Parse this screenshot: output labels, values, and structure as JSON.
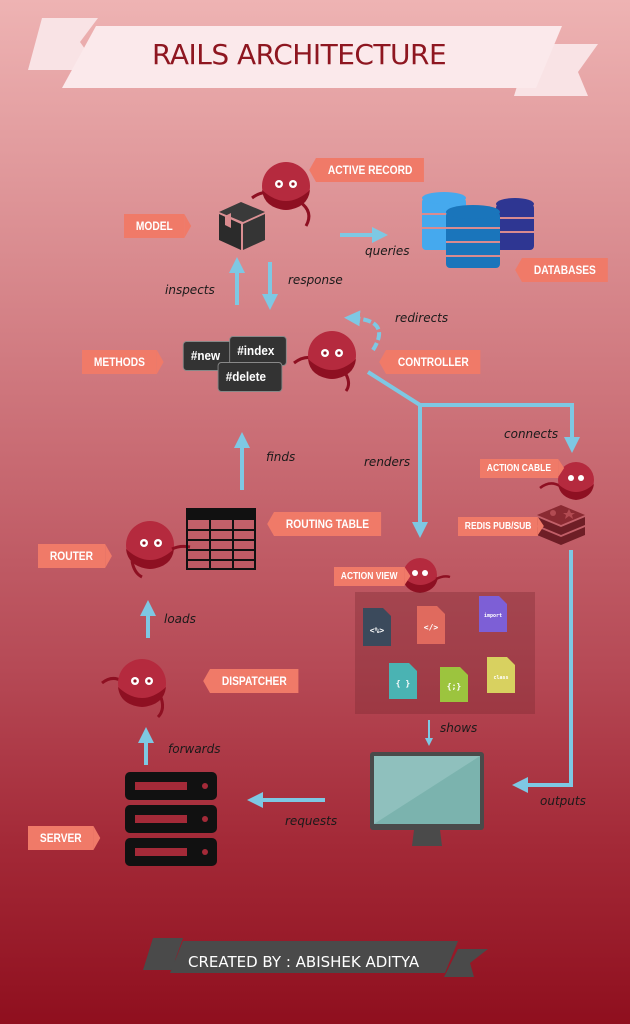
{
  "title": "RAILS ARCHITECTURE",
  "credit": "CREATED BY : ABISHEK ADITYA",
  "colors": {
    "tag": "#f07a68",
    "arrow": "#7ec8e3",
    "title_text": "#8e1620",
    "creature": "#b52a3e",
    "icon_dark": "#2b2b2b"
  },
  "labels": {
    "active_record": "ACTIVE RECORD",
    "model": "MODEL",
    "databases": "DATABASES",
    "methods": "METHODS",
    "controller": "CONTROLLER",
    "action_cable": "ACTION CABLE",
    "redis": "REDIS PUB/SUB",
    "routing_table": "ROUTING TABLE",
    "router": "ROUTER",
    "action_view": "ACTION VIEW",
    "dispatcher": "DISPATCHER",
    "server": "SERVER"
  },
  "notes": {
    "queries": "queries",
    "inspects": "inspects",
    "response": "response",
    "redirects": "redirects",
    "connects": "connects",
    "renders": "renders",
    "finds": "finds",
    "loads": "loads",
    "shows": "shows",
    "forwards": "forwards",
    "requests": "requests",
    "outputs": "outputs"
  },
  "methods": [
    "#new",
    "#index",
    "#delete"
  ],
  "view_files": [
    {
      "icon": "erb-file-icon",
      "glyph": "<%>",
      "color": "#3b4a5c"
    },
    {
      "icon": "html-file-icon",
      "glyph": "</>",
      "color": "#e06a5e"
    },
    {
      "icon": "import-file-icon",
      "glyph": "import",
      "color": "#7d5fd6"
    },
    {
      "icon": "json-file-icon",
      "glyph": "{ }",
      "color": "#4ab3b3"
    },
    {
      "icon": "css-file-icon",
      "glyph": "{;}",
      "color": "#9cc43e"
    },
    {
      "icon": "coffee-file-icon",
      "glyph": "class",
      "color": "#d8d160"
    }
  ]
}
